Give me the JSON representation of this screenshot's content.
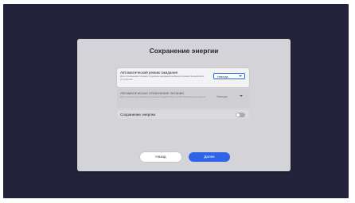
{
  "dialog": {
    "title": "Сохранение энергии",
    "settings": [
      {
        "label": "Автоматический режим ожидания",
        "description": "Для отключения питания в режиме ожидания выберите время бездействия устройства",
        "value": "Никогда",
        "enabled": true,
        "icon": "chevron-down-icon"
      },
      {
        "label": "Автоматическое отключение питания",
        "description": "Для отключения питания в режиме бездействия устройства выберите время",
        "value": "Никогда",
        "enabled": false,
        "icon": "chevron-down-icon"
      }
    ],
    "energy_saving": {
      "label": "Сохранение энергии",
      "on": false
    },
    "buttons": {
      "back": "Назад",
      "next": "Далее"
    }
  },
  "colors": {
    "background": "#22223a",
    "dialog": "#d4d4d8",
    "accent": "#2f63e8"
  }
}
